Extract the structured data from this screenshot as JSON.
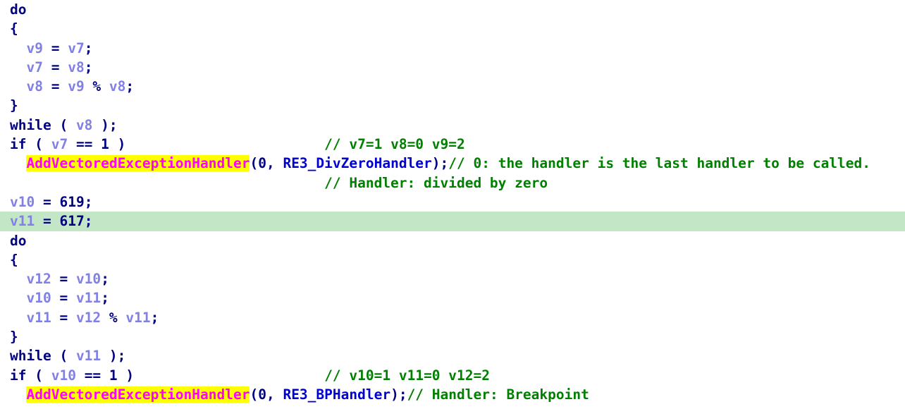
{
  "view": {
    "name": "pseudocode-view",
    "background_color": "#ffffff",
    "current_line_highlight_color": "#c3e6c6",
    "search_highlight_bg": "#ffff00",
    "search_highlight_fg": "#ff00ff",
    "keyword_color": "#000080",
    "variable_color": "#8080e6",
    "symbol_color": "#0000d0",
    "comment_color": "#008000",
    "current_line_index": 10,
    "highlighted_token": "AddVectoredExceptionHandler"
  },
  "lines": [
    {
      "index": 0,
      "text": "do"
    },
    {
      "index": 1,
      "text": "{"
    },
    {
      "index": 2,
      "text": "  v9 = v7;"
    },
    {
      "index": 3,
      "text": "  v7 = v8;"
    },
    {
      "index": 4,
      "text": "  v8 = v9 % v8;"
    },
    {
      "index": 5,
      "text": "}"
    },
    {
      "index": 6,
      "text": "while ( v8 );"
    },
    {
      "index": 7,
      "text": "if ( v7 == 1 )                        // v7=1 v8=0 v9=2"
    },
    {
      "index": 8,
      "text": "  AddVectoredExceptionHandler(0, RE3_DivZeroHandler);// 0: the handler is the last handler to be called."
    },
    {
      "index": 9,
      "text": "                                      // Handler: divided by zero"
    },
    {
      "index": 10,
      "text": "v10 = 619;"
    },
    {
      "index": 11,
      "text": "v11 = 617;"
    },
    {
      "index": 12,
      "text": "do"
    },
    {
      "index": 13,
      "text": "{"
    },
    {
      "index": 14,
      "text": "  v12 = v10;"
    },
    {
      "index": 15,
      "text": "  v10 = v11;"
    },
    {
      "index": 16,
      "text": "  v11 = v12 % v11;"
    },
    {
      "index": 17,
      "text": "}"
    },
    {
      "index": 18,
      "text": "while ( v11 );"
    },
    {
      "index": 19,
      "text": "if ( v10 == 1 )                       // v10=1 v11=0 v12=2"
    },
    {
      "index": 20,
      "text": "  AddVectoredExceptionHandler(0, RE3_BPHandler);// Handler: Breakpoint"
    }
  ],
  "identifiers": {
    "variables": [
      "v7",
      "v8",
      "v9",
      "v10",
      "v11",
      "v12"
    ],
    "functions": [
      "AddVectoredExceptionHandler"
    ],
    "symbols": [
      "RE3_DivZeroHandler",
      "RE3_BPHandler"
    ],
    "keywords": [
      "do",
      "while",
      "if"
    ],
    "numbers": [
      "0",
      "1",
      "2",
      "617",
      "619"
    ]
  },
  "comments": [
    "// v7=1 v8=0 v9=2",
    "// 0: the handler is the last handler to be called.",
    "// Handler: divided by zero",
    "// v10=1 v11=0 v12=2",
    "// Handler: Breakpoint"
  ],
  "code": {
    "l0": {
      "kw_do": "do"
    },
    "l1": {
      "brace": "{"
    },
    "l2": {
      "indent": "  ",
      "lhs": "v9",
      "eq": " = ",
      "rhs": "v7",
      "semi": ";"
    },
    "l3": {
      "indent": "  ",
      "lhs": "v7",
      "eq": " = ",
      "rhs": "v8",
      "semi": ";"
    },
    "l4": {
      "indent": "  ",
      "lhs": "v8",
      "eq": " = ",
      "a": "v9",
      "op": " % ",
      "b": "v8",
      "semi": ";"
    },
    "l5": {
      "brace": "}"
    },
    "l6": {
      "kw_while": "while",
      "open": " ( ",
      "cond": "v8",
      "close": " );"
    },
    "l7": {
      "kw_if": "if",
      "open": " ( ",
      "cond": "v7",
      "cmp": " == ",
      "num": "1",
      "close": " )",
      "pad": "                        ",
      "comment": "// v7=1 v8=0 v9=2"
    },
    "l8": {
      "indent": "  ",
      "fn": "AddVectoredExceptionHandler",
      "open": "(",
      "arg0": "0",
      "comma": ", ",
      "arg1": "RE3_DivZeroHandler",
      "close": ");",
      "comment": "// 0: the handler is the last handler to be called."
    },
    "l9": {
      "pad": "                                      ",
      "comment": "// Handler: divided by zero"
    },
    "l10": {
      "lhs": "v10",
      "eq": " = ",
      "num": "619",
      "semi": ";"
    },
    "l11": {
      "lhs": "v11",
      "eq": " = ",
      "num": "617",
      "semi": ";"
    },
    "l12": {
      "kw_do": "do"
    },
    "l13": {
      "brace": "{"
    },
    "l14": {
      "indent": "  ",
      "lhs": "v12",
      "eq": " = ",
      "rhs": "v10",
      "semi": ";"
    },
    "l15": {
      "indent": "  ",
      "lhs": "v10",
      "eq": " = ",
      "rhs": "v11",
      "semi": ";"
    },
    "l16": {
      "indent": "  ",
      "lhs": "v11",
      "eq": " = ",
      "a": "v12",
      "op": " % ",
      "b": "v11",
      "semi": ";"
    },
    "l17": {
      "brace": "}"
    },
    "l18": {
      "kw_while": "while",
      "open": " ( ",
      "cond": "v11",
      "close": " );"
    },
    "l19": {
      "kw_if": "if",
      "open": " ( ",
      "cond": "v10",
      "cmp": " == ",
      "num": "1",
      "close": " )",
      "pad": "                       ",
      "comment": "// v10=1 v11=0 v12=2"
    },
    "l20": {
      "indent": "  ",
      "fn": "AddVectoredExceptionHandler",
      "open": "(",
      "arg0": "0",
      "comma": ", ",
      "arg1": "RE3_BPHandler",
      "close": ");",
      "comment": "// Handler: Breakpoint"
    }
  }
}
